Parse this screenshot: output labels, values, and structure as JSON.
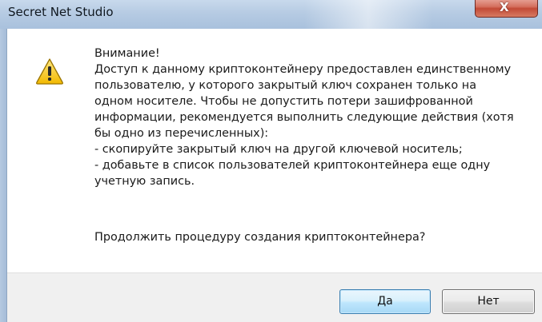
{
  "window": {
    "title": "Secret Net Studio",
    "close_glyph": "X"
  },
  "icon": {
    "name": "warning-icon",
    "colors": {
      "fill": "#f7c600",
      "outline": "#8a6a00",
      "mark": "#2a2a2a"
    }
  },
  "message": {
    "lines": [
      "Внимание!",
      "Доступ к данному криптоконтейнеру предоставлен единственному",
      "пользователю, у которого закрытый ключ сохранен только на",
      "одном носителе. Чтобы не допустить потери зашифрованной",
      "информации, рекомендуется выполнить следующие действия (хотя",
      "бы одно из перечисленных):",
      "- скопируйте закрытый ключ на другой ключевой носитель;",
      "- добавьте в список пользователей криптоконтейнера еще одну",
      "учетную запись."
    ],
    "question": "Продолжить процедуру создания криптоконтейнера?"
  },
  "buttons": {
    "yes_label": "Да",
    "no_label": "Нет"
  }
}
